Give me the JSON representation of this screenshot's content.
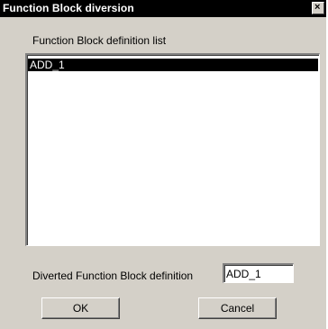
{
  "window": {
    "title": "Function Block diversion",
    "close_glyph": "×"
  },
  "definition_list": {
    "label": "Function Block definition list",
    "items": [
      "ADD_1"
    ],
    "selected_index": 0
  },
  "diverted": {
    "label": "Diverted Function Block definition",
    "value": "ADD_1"
  },
  "buttons": {
    "ok": "OK",
    "cancel": "Cancel"
  },
  "colors": {
    "titlebar": "#000000",
    "dialog_face": "#d4d0c8",
    "selection": "#000000"
  }
}
